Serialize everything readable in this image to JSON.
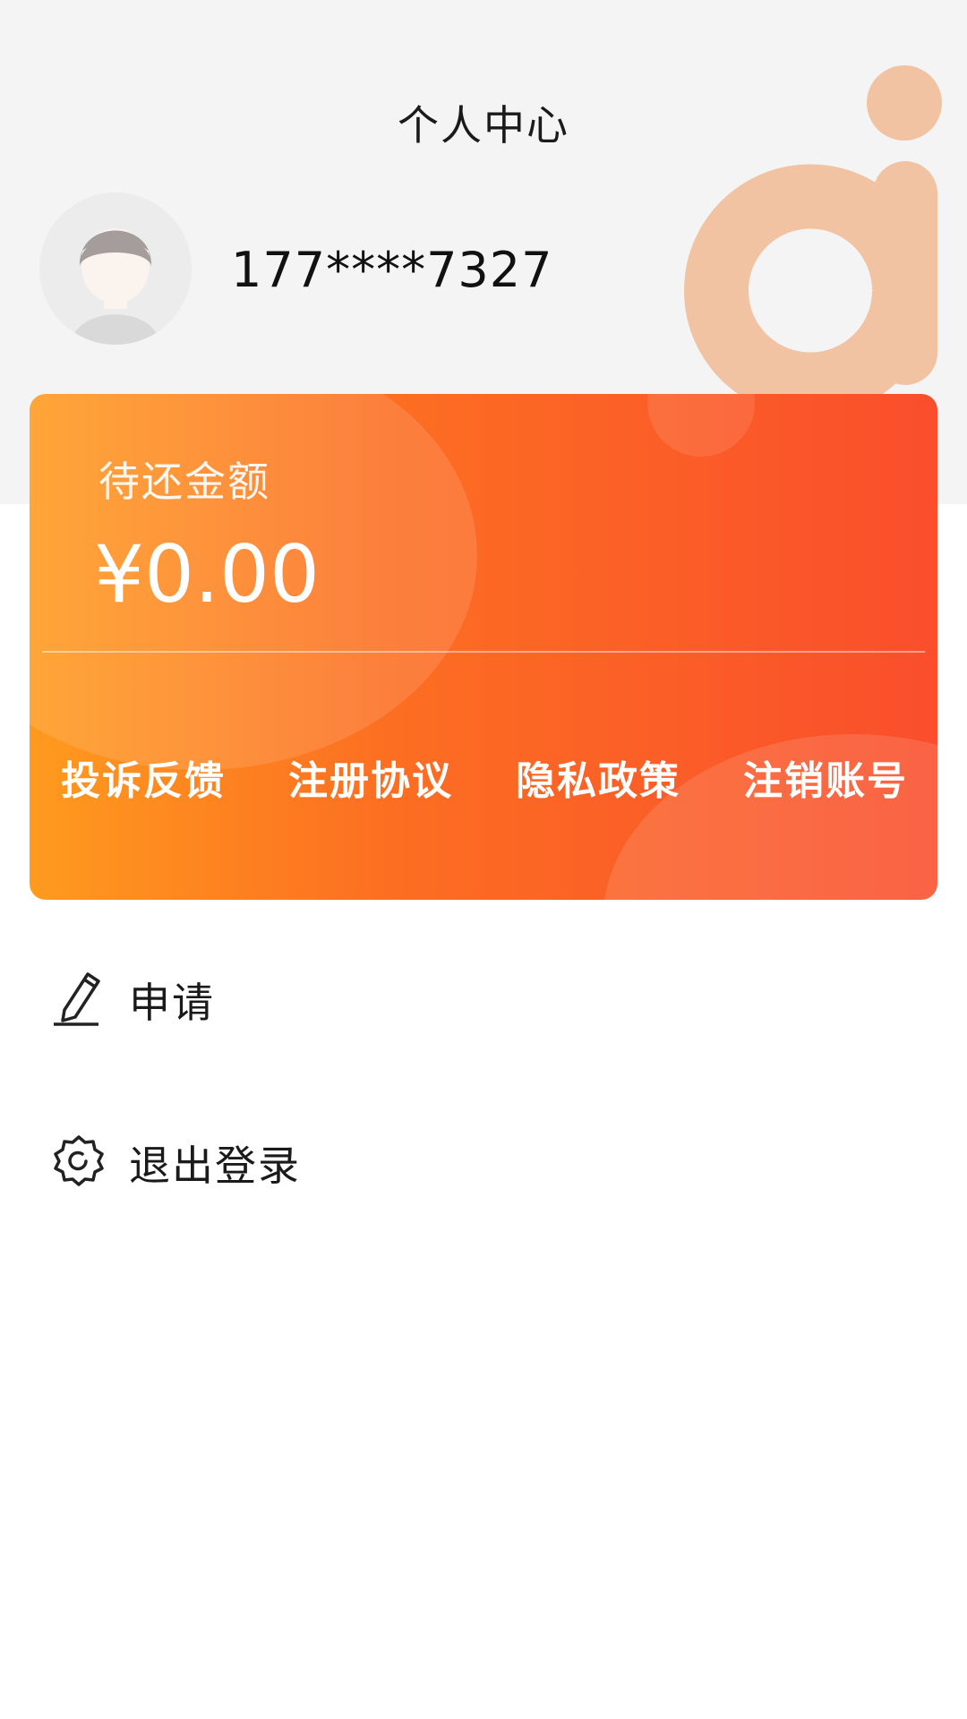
{
  "header": {
    "title": "个人中心",
    "phone": "177****7327"
  },
  "card": {
    "label": "待还金额",
    "amount": "¥0.00",
    "links": [
      {
        "label": "投诉反馈"
      },
      {
        "label": "注册协议"
      },
      {
        "label": "隐私政策"
      },
      {
        "label": "注销账号"
      }
    ]
  },
  "menu": {
    "items": [
      {
        "label": "申请",
        "icon": "pencil-icon"
      },
      {
        "label": "退出登录",
        "icon": "gear-icon"
      }
    ]
  },
  "colors": {
    "header_bg": "#f4f4f4",
    "card_gradient_start": "#ff9a1e",
    "card_gradient_end": "#fa4e2c",
    "logo_color": "#f2c3a3"
  }
}
